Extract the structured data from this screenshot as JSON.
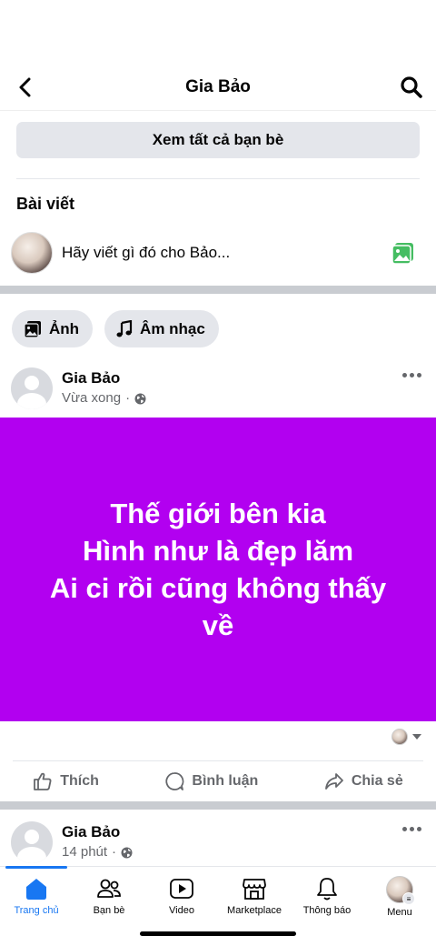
{
  "header": {
    "title": "Gia Bảo"
  },
  "friends": {
    "see_all_label": "Xem tất cả bạn bè"
  },
  "posts_section": {
    "title": "Bài viết"
  },
  "composer": {
    "placeholder": "Hãy viết gì đó cho Bảo..."
  },
  "chips": [
    {
      "label": "Ảnh",
      "icon": "photo-icon"
    },
    {
      "label": "Âm nhạc",
      "icon": "music-note-icon"
    }
  ],
  "post1": {
    "author": "Gia Bảo",
    "time": "Vừa xong",
    "audience_icon": "globe-icon",
    "text": "Thế giới bên kia\nHình như là đẹp lăm\nAi ci rồi cũng không thấy\nvề",
    "background_color": "#b200f0"
  },
  "actions": {
    "like": "Thích",
    "comment": "Bình luận",
    "share": "Chia sẻ"
  },
  "post2": {
    "author": "Gia Bảo",
    "time": "14 phút",
    "audience_icon": "globe-icon"
  },
  "tabbar": {
    "items": [
      {
        "label": "Trang chủ",
        "icon": "home-icon",
        "active": true
      },
      {
        "label": "Bạn bè",
        "icon": "friends-icon"
      },
      {
        "label": "Video",
        "icon": "video-icon"
      },
      {
        "label": "Marketplace",
        "icon": "marketplace-icon"
      },
      {
        "label": "Thông báo",
        "icon": "bell-icon"
      },
      {
        "label": "Menu",
        "icon": "menu-avatar"
      }
    ]
  },
  "colors": {
    "accent": "#1877f2",
    "chip_bg": "#e4e6eb",
    "secondary_text": "#65676b"
  }
}
